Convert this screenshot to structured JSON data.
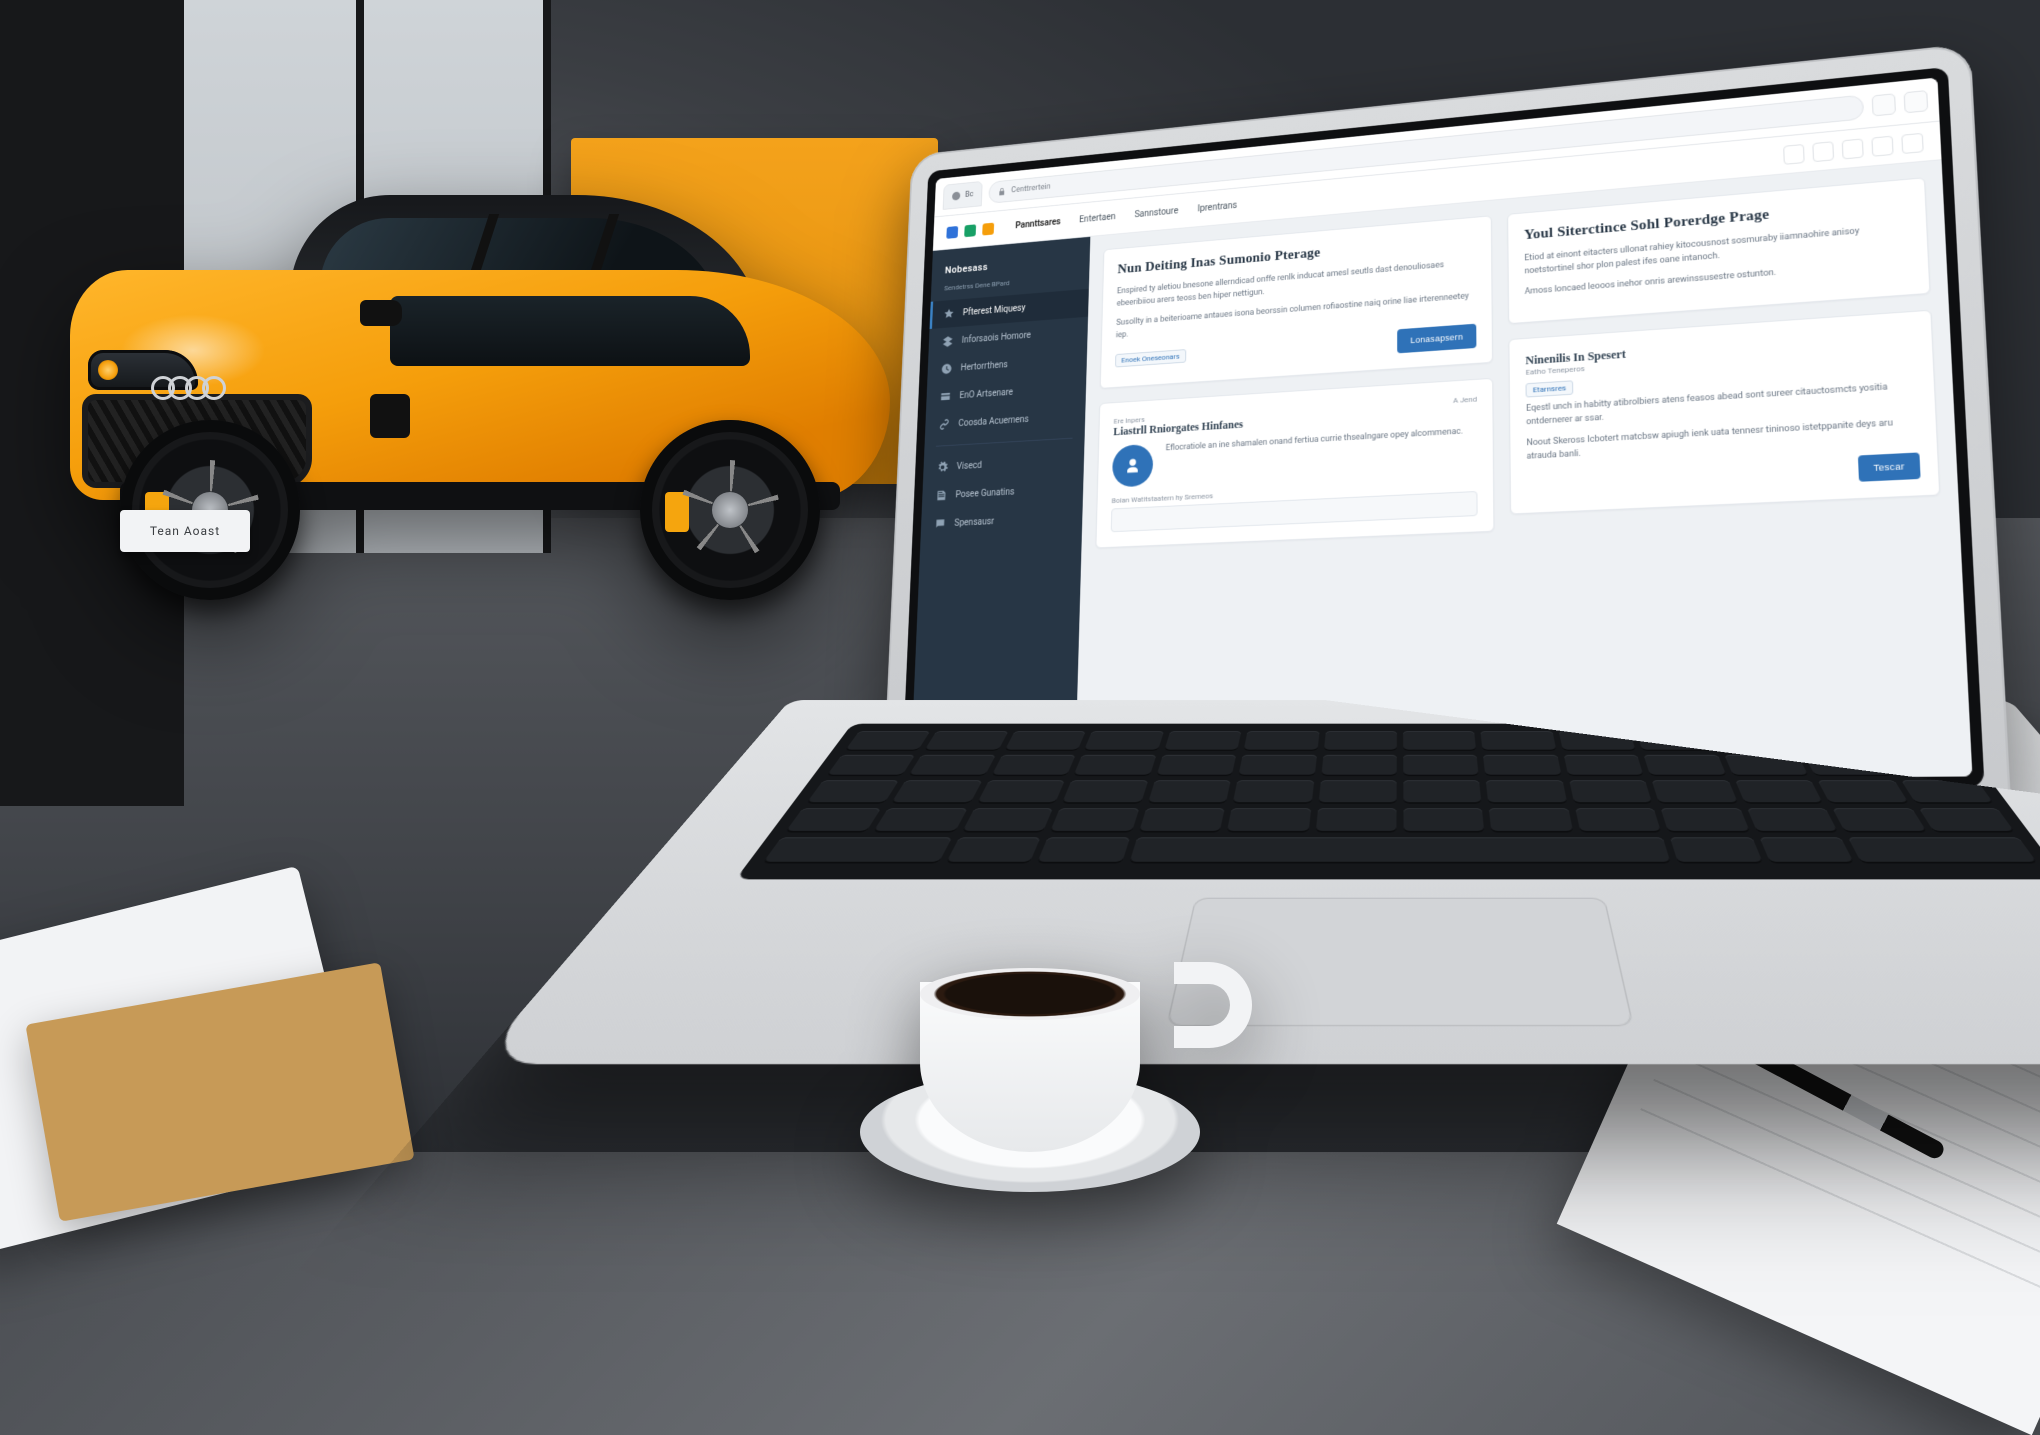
{
  "scene": {
    "car_plate": "Tean Aoast"
  },
  "browser": {
    "tab_prefix": "Bc",
    "tab_title": "Centtrertein",
    "url_hint": "secure connection"
  },
  "topnav": {
    "items": [
      "Pannttsares",
      "Entertaen",
      "Sannstoure",
      "Iprentrans"
    ]
  },
  "sidebar": {
    "title": "Nobesass",
    "subtitle": "Sendetrss Dene BPard",
    "items": [
      {
        "icon": "star",
        "label": "Pfterest Miquesy"
      },
      {
        "icon": "layers",
        "label": "Inforsaois Homore"
      },
      {
        "icon": "clock",
        "label": "Hertorrthens"
      },
      {
        "icon": "card",
        "label": "EnO Artsenare"
      },
      {
        "icon": "link",
        "label": "Coosda Acuemens"
      },
      {
        "icon": "gear",
        "label": "Visecd"
      },
      {
        "icon": "note",
        "label": "Posee Gunatins"
      },
      {
        "icon": "chat",
        "label": "Spensausr"
      }
    ],
    "active_index": 0
  },
  "main": {
    "left": {
      "hero": {
        "title": "Nun Deiting Inas Sumonio Pterage",
        "body1": "Enspired ty aletiou bnesone allerndicad onffe renlk inducat amesl seutls dast denouliosaes ebeeribiiou arers teoss ben hiper nettigun.",
        "body2": "Susollty in a beiterioame antaues isona beorssin columen rofiaostine naiq orine liae irterenneetey iep.",
        "tag": "Enoek Oneseonars",
        "cta": "Lonasapsern"
      },
      "feature": {
        "eyebrow": "Ere Inpers",
        "title": "Liastrll Rniorgates Hinfanes",
        "meta": "A Jend",
        "body": "Eflocratiole an ine shamalen onand fertiua currie thsealngare opey alcommenac.",
        "input_label": "Boian  Watitstaatern hy Sremeos"
      }
    },
    "right": {
      "promo": {
        "title": "Youl Siterctince Sohl Porerdge Prage",
        "body1": "Etiod at einont eitacters ullonat rahiey kitocousnost sosmuraby iiamnaohire anisoy noetstortinel shor plon palest ifes oane intanoch.",
        "body2": "Amoss loncaed leooos inehor onris arewinssusestre ostunton."
      },
      "details": {
        "title": "Ninenilis In Spesert",
        "meta": "Eatho Teneperos",
        "link": "Etarnsres",
        "body1": "Eqestl unch in habitty atibrolbiers atens feasos abead sont sureer citauctosmcts yositia ontdernerer ar ssar.",
        "body2": "Noout Skeross Icbotert matcbsw apiugh ienk uata tennesr tininoso istetppanite deys aru atrauda banli.",
        "cta": "Tescar"
      }
    }
  },
  "icons": {
    "star": "star-icon",
    "layers": "layers-icon",
    "clock": "clock-icon",
    "card": "card-icon",
    "link": "link-icon",
    "gear": "gear-icon",
    "note": "note-icon",
    "chat": "chat-icon",
    "lock": "lock-icon"
  },
  "colors": {
    "accent": "#2f72b8",
    "sidebar": "#273645",
    "car": "#f59e0b"
  }
}
